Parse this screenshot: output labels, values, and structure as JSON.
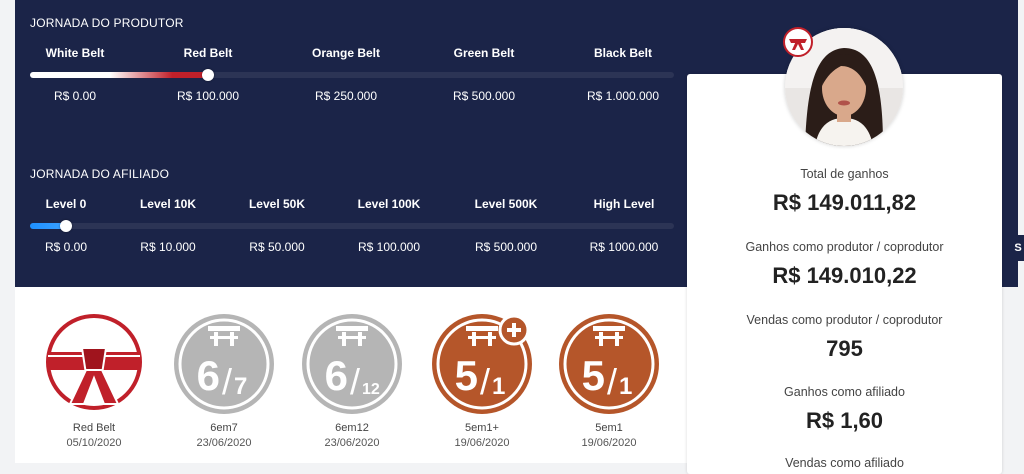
{
  "produtor": {
    "title": "JORNADA DO PRODUTOR",
    "progress_stop": 1,
    "levels": [
      {
        "name": "White Belt",
        "amount": "R$ 0.00"
      },
      {
        "name": "Red Belt",
        "amount": "R$ 100.000"
      },
      {
        "name": "Orange Belt",
        "amount": "R$ 250.000"
      },
      {
        "name": "Green Belt",
        "amount": "R$ 500.000"
      },
      {
        "name": "Black Belt",
        "amount": "R$ 1.000.000"
      }
    ]
  },
  "afiliado": {
    "title": "JORNADA DO AFILIADO",
    "progress_stop": 0,
    "levels": [
      {
        "name": "Level 0",
        "amount": "R$ 0.00"
      },
      {
        "name": "Level 10K",
        "amount": "R$ 10.000"
      },
      {
        "name": "Level 50K",
        "amount": "R$ 50.000"
      },
      {
        "name": "Level 100K",
        "amount": "R$ 100.000"
      },
      {
        "name": "Level 500K",
        "amount": "R$ 500.000"
      },
      {
        "name": "High Level",
        "amount": "R$ 1000.000"
      }
    ]
  },
  "badges": [
    {
      "kind": "belt",
      "name": "Red Belt",
      "date": "05/10/2020",
      "color": "#c0202a"
    },
    {
      "kind": "medal",
      "big": "6",
      "small": "7",
      "name": "6em7",
      "date": "23/06/2020",
      "color": "#b5b5b5"
    },
    {
      "kind": "medal",
      "big": "6",
      "small": "12",
      "name": "6em12",
      "date": "23/06/2020",
      "color": "#b5b5b5"
    },
    {
      "kind": "medal",
      "big": "5",
      "small": "1",
      "plus": true,
      "name": "5em1+",
      "date": "19/06/2020",
      "color": "#b5562a"
    },
    {
      "kind": "medal",
      "big": "5",
      "small": "1",
      "name": "5em1",
      "date": "19/06/2020",
      "color": "#b5562a"
    }
  ],
  "stats": {
    "total_label": "Total de ganhos",
    "total_value": "R$ 149.011,82",
    "produtor_label": "Ganhos como produtor / coprodutor",
    "produtor_value": "R$ 149.010,22",
    "vendas_label": "Vendas como produtor / coprodutor",
    "vendas_value": "795",
    "afiliado_label": "Ganhos como afiliado",
    "afiliado_value": "R$ 1,60",
    "vendas_afiliado_label": "Vendas como afiliado"
  },
  "edge_tab": "S",
  "colors": {
    "navy": "#1b2448",
    "red": "#c0202a",
    "blue": "#1e90ff"
  }
}
